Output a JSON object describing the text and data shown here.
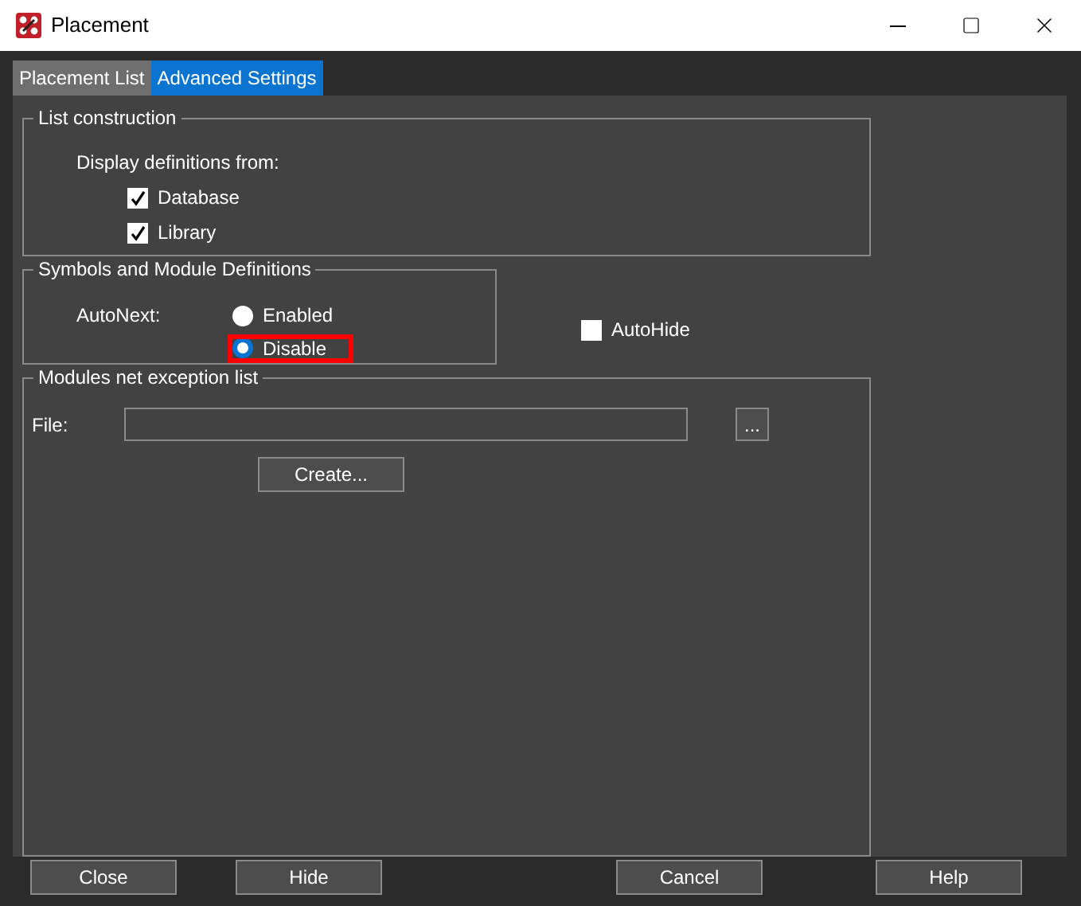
{
  "window": {
    "title": "Placement"
  },
  "tabs": [
    {
      "label": "Placement List",
      "selected": false
    },
    {
      "label": "Advanced Settings",
      "selected": true
    }
  ],
  "list_construction": {
    "title": "List construction",
    "label": "Display definitions from:",
    "options": [
      {
        "label": "Database",
        "checked": true
      },
      {
        "label": "Library",
        "checked": true
      }
    ]
  },
  "symbols": {
    "title": "Symbols and Module Definitions",
    "label": "AutoNext:",
    "radios": [
      {
        "label": "Enabled",
        "selected": false
      },
      {
        "label": "Disable",
        "selected": true
      }
    ]
  },
  "autohide": {
    "label": "AutoHide",
    "checked": false
  },
  "exception_list": {
    "title": "Modules net exception list",
    "file_label": "File:",
    "browse": "...",
    "create": "Create..."
  },
  "buttons": [
    "Close",
    "Hide",
    "Cancel",
    "Help"
  ]
}
